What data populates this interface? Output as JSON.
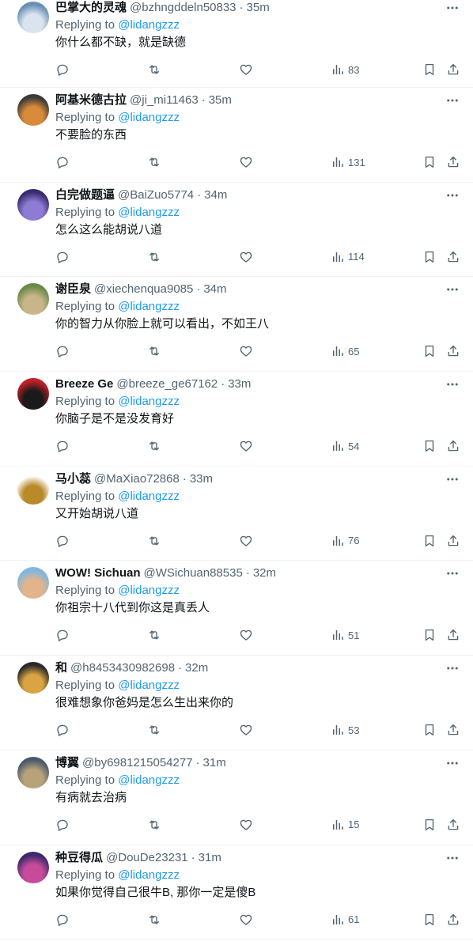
{
  "replying_prefix": "Replying to",
  "mention": "@lidangzzz",
  "separator": "·",
  "tweets": [
    {
      "name": "巴掌大的灵魂",
      "handle": "@bzhngddeln50833",
      "time": "35m",
      "text": "你什么都不缺，就是缺德",
      "views": "83",
      "avatar_colors": [
        "#6a8fb5",
        "#d9e4ef"
      ]
    },
    {
      "name": "阿基米德古拉",
      "handle": "@ji_mi11463",
      "time": "35m",
      "text": "不要脸的东西",
      "views": "131",
      "avatar_colors": [
        "#3b3a36",
        "#d98a3a"
      ]
    },
    {
      "name": "白完做题逼",
      "handle": "@BaiZuo5774",
      "time": "34m",
      "text": "怎么这么能胡说八道",
      "views": "114",
      "avatar_colors": [
        "#3a2b6e",
        "#8d7bd4"
      ]
    },
    {
      "name": "谢臣泉",
      "handle": "@xiechenqua9085",
      "time": "34m",
      "text": "你的智力从你脸上就可以看出，不如王八",
      "views": "65",
      "avatar_colors": [
        "#6b8a4a",
        "#c9b58a"
      ]
    },
    {
      "name": "Breeze Ge",
      "handle": "@breeze_ge67162",
      "time": "33m",
      "text": "你脑子是不是没发育好",
      "views": "54",
      "avatar_colors": [
        "#c0202a",
        "#1a1a1a"
      ]
    },
    {
      "name": "马小蕊",
      "handle": "@MaXiao72868",
      "time": "33m",
      "text": "又开始胡说八道",
      "views": "76",
      "avatar_colors": [
        "#ffffff",
        "#b88a2a"
      ]
    },
    {
      "name": "WOW! Sichuan",
      "handle": "@WSichuan88535",
      "time": "32m",
      "text": "你祖宗十八代到你这是真丢人",
      "views": "51",
      "avatar_colors": [
        "#7fb7e0",
        "#e2b48c"
      ]
    },
    {
      "name": "和",
      "handle": "@h8453430982698",
      "time": "32m",
      "text": "很难想象你爸妈是怎么生出来你的",
      "views": "53",
      "avatar_colors": [
        "#2a2a2a",
        "#d9a441"
      ]
    },
    {
      "name": "博翼",
      "handle": "@by6981215054277",
      "time": "31m",
      "text": "有病就去治病",
      "views": "15",
      "avatar_colors": [
        "#4a5a6a",
        "#b8a27a"
      ]
    },
    {
      "name": "种豆得瓜",
      "handle": "@DouDe23231",
      "time": "31m",
      "text": "如果你觉得自己很牛B, 那你一定是傻B",
      "views": "61",
      "avatar_colors": [
        "#3a2a6a",
        "#c84a9a"
      ]
    }
  ]
}
